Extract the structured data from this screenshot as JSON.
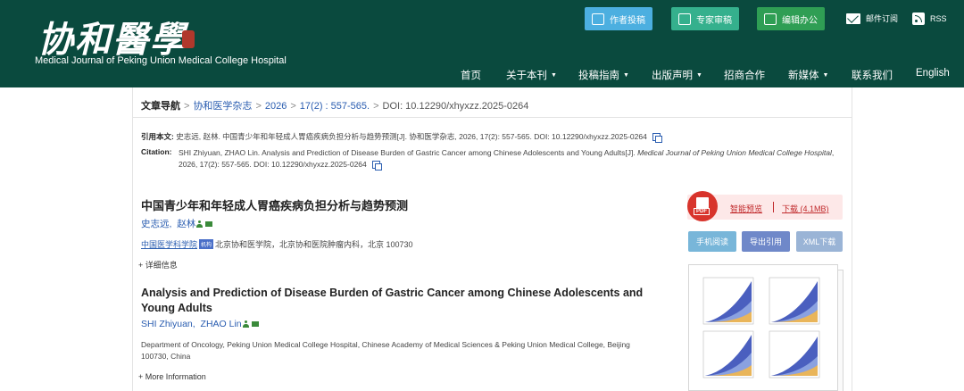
{
  "header": {
    "logo_cn": "协和醫學",
    "logo_en": "Medical Journal of Peking Union Medical College Hospital",
    "top_buttons": [
      {
        "label": "作者投稿",
        "icon": "person-icon"
      },
      {
        "label": "专家审稿",
        "icon": "review-icon"
      },
      {
        "label": "编辑办公",
        "icon": "edit-icon"
      }
    ],
    "mail_label": "邮件订阅",
    "rss_label": "RSS",
    "nav": [
      {
        "label": "首页",
        "dropdown": false
      },
      {
        "label": "关于本刊",
        "dropdown": true
      },
      {
        "label": "投稿指南",
        "dropdown": true
      },
      {
        "label": "出版声明",
        "dropdown": true
      },
      {
        "label": "招商合作",
        "dropdown": false
      },
      {
        "label": "新媒体",
        "dropdown": true
      },
      {
        "label": "联系我们",
        "dropdown": false
      },
      {
        "label": "English",
        "dropdown": false
      }
    ],
    "colors": {
      "background": "#0a4a3e",
      "author_btn": "#4cafe0",
      "expert_btn": "#35b08d",
      "editor_btn": "#2f9e54"
    }
  },
  "breadcrumb": {
    "label": "文章导航",
    "journal": "协和医学杂志",
    "year": "2026",
    "issue": "17(2) : 557-565.",
    "doi": "DOI: 10.12290/xhyxzz.2025-0264"
  },
  "citation": {
    "cn_label": "引用本文:",
    "cn_text": "史志远, 赵林. 中国青少年和年轻成人胃癌疾病负担分析与趋势预测[J]. 协和医学杂志, 2026, 17(2): 557-565. DOI: 10.12290/xhyxzz.2025-0264",
    "en_label": "Citation:",
    "en_main": "SHI Zhiyuan, ZHAO Lin. Analysis and Prediction of Disease Burden of Gastric Cancer among Chinese Adolescents and Young Adults[J].",
    "en_journal": "Medical Journal of Peking Union Medical College Hospital",
    "en_tail": ", 2026, 17(2): 557-565. DOI: 10.12290/xhyxzz.2025-0264"
  },
  "article_cn": {
    "title": "中国青少年和年轻成人胃癌疾病负担分析与趋势预测",
    "author1": "史志远",
    "author_sep": ",",
    "author2": "赵林",
    "affil_link": "中国医学科学院",
    "affil_badge": "机构",
    "affil_rest": "北京协和医学院，北京协和医院肿瘤内科，北京 100730",
    "more": "+ 详细信息"
  },
  "article_en": {
    "title": "Analysis and Prediction of Disease Burden of Gastric Cancer among Chinese Adolescents and Young Adults",
    "author1": "SHI Zhiyuan",
    "author_sep": ",",
    "author2": "ZHAO Lin",
    "affiliation": "Department of Oncology, Peking Union Medical College Hospital, Chinese Academy of Medical Sciences & Peking Union Medical College, Beijing 100730, China",
    "more": "+ More Information"
  },
  "actions": {
    "pdf_badge": "PDF",
    "smart_preview": "智能预览",
    "download": "下载 (4.1MB)",
    "mobile": "手机阅读",
    "export": "导出引用",
    "xml": "XML下载",
    "colors": {
      "mobile": "#78b6d9",
      "export": "#6f88c9",
      "xml": "#9ab4d6",
      "pdf": "#d8342c"
    }
  }
}
